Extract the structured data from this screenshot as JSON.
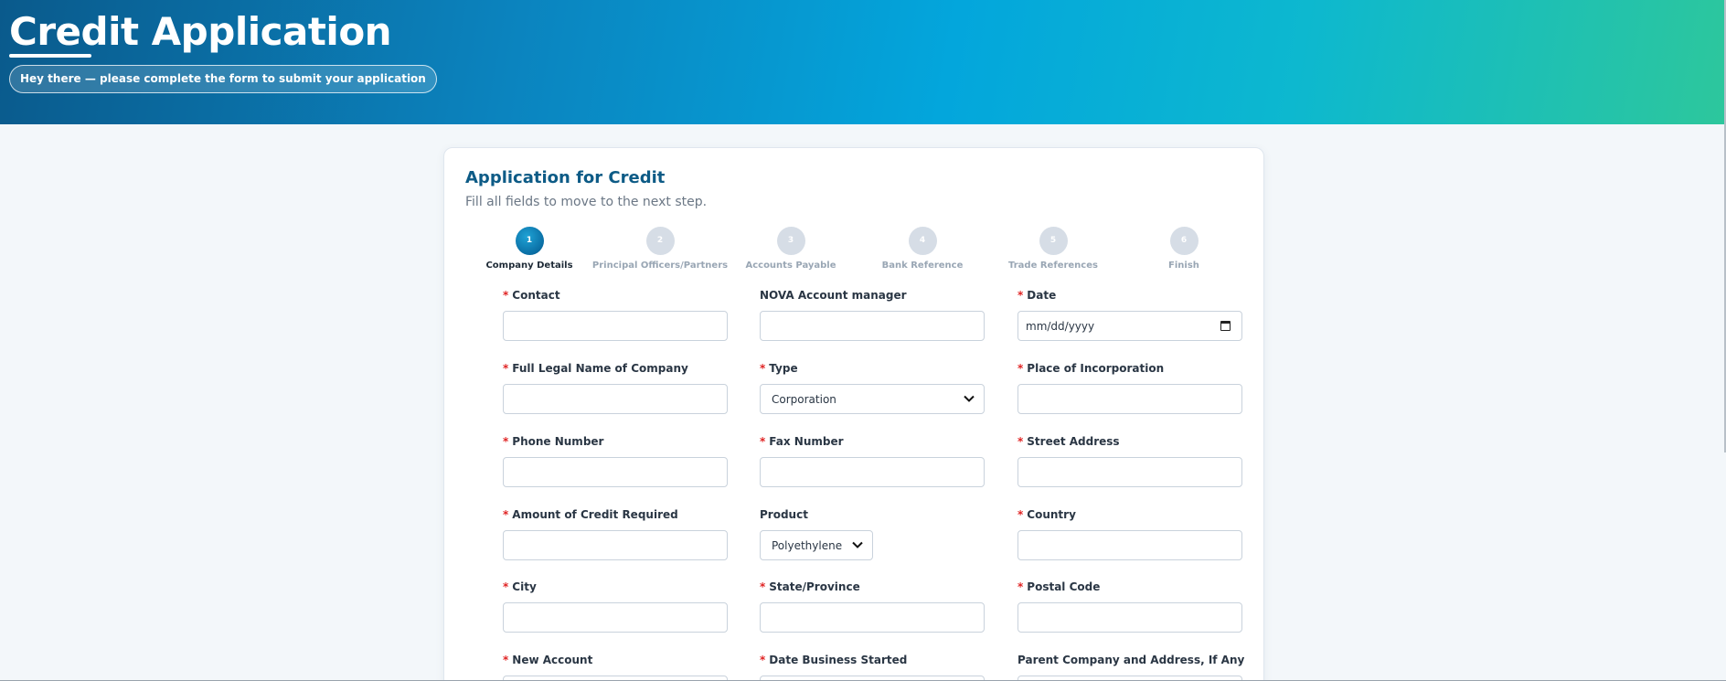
{
  "hero": {
    "title": "Credit Application",
    "subtitle": "Hey there — please complete the form to submit your application"
  },
  "card": {
    "title": "Application for Credit",
    "subtitle": "Fill all fields to move to the next step."
  },
  "steps": [
    {
      "number": "1",
      "label": "Company Details",
      "active": true
    },
    {
      "number": "2",
      "label": "Principal Officers/Partners",
      "active": false
    },
    {
      "number": "3",
      "label": "Accounts Payable",
      "active": false
    },
    {
      "number": "4",
      "label": "Bank Reference",
      "active": false
    },
    {
      "number": "5",
      "label": "Trade References",
      "active": false
    },
    {
      "number": "6",
      "label": "Finish",
      "active": false
    }
  ],
  "fields": {
    "contact": {
      "label": "Contact",
      "required": "*",
      "value": ""
    },
    "account_manager": {
      "label": "NOVA Account manager",
      "value": ""
    },
    "date": {
      "label": "Date",
      "required": "*",
      "placeholder": "mm/dd/yyyy",
      "icon": "calendar-icon"
    },
    "legal_name": {
      "label": "Full Legal Name of Company",
      "required": "*",
      "value": ""
    },
    "type": {
      "label": "Type",
      "required": "*",
      "selected": "Corporation",
      "icon": "chevron-down-icon"
    },
    "place_incorporation": {
      "label": "Place of Incorporation",
      "required": "*",
      "value": ""
    },
    "phone": {
      "label": "Phone Number",
      "required": "*",
      "value": ""
    },
    "fax": {
      "label": "Fax Number",
      "required": "*",
      "value": ""
    },
    "street": {
      "label": "Street Address",
      "required": "*",
      "value": ""
    },
    "credit_amount": {
      "label": "Amount of Credit Required",
      "required": "*",
      "value": ""
    },
    "product": {
      "label": "Product",
      "selected": "Polyethylene",
      "icon": "chevron-down-icon"
    },
    "country": {
      "label": "Country",
      "required": "*",
      "value": ""
    },
    "city": {
      "label": "City",
      "required": "*",
      "value": ""
    },
    "state": {
      "label": "State/Province",
      "required": "*",
      "value": ""
    },
    "postal": {
      "label": "Postal Code",
      "required": "*",
      "value": ""
    },
    "new_account": {
      "label": "New Account",
      "required": "*",
      "value": ""
    },
    "date_started": {
      "label": "Date Business Started",
      "required": "*",
      "value": ""
    },
    "parent_company": {
      "label": "Parent Company and Address, If Any",
      "value": ""
    }
  },
  "colors": {
    "brand": "#0d5b86",
    "required": "#e02424",
    "step_active": "#0a6ea4",
    "step_inactive": "#d6dde6"
  }
}
